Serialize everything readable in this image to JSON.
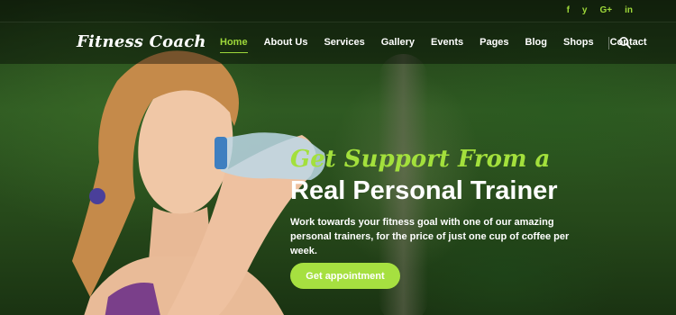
{
  "brand": {
    "logo_text": "Fitness Coach"
  },
  "social": {
    "items": [
      {
        "icon": "facebook-icon",
        "glyph": "f"
      },
      {
        "icon": "twitter-icon",
        "glyph": "y"
      },
      {
        "icon": "google-plus-icon",
        "glyph": "G+"
      },
      {
        "icon": "linkedin-icon",
        "glyph": "in"
      }
    ]
  },
  "nav": {
    "items": [
      "Home",
      "About Us",
      "Services",
      "Gallery",
      "Events",
      "Pages",
      "Blog",
      "Shops",
      "Contact"
    ],
    "active": "Home"
  },
  "hero": {
    "headline_script": "Get Support From a",
    "headline_main": "Real Personal Trainer",
    "description": "Work towards your fitness goal with one of our amazing personal trainers, for the price of just one cup of coffee per week.",
    "cta_label": "Get appointment"
  },
  "colors": {
    "accent": "#a6e040",
    "text": "#ffffff"
  }
}
